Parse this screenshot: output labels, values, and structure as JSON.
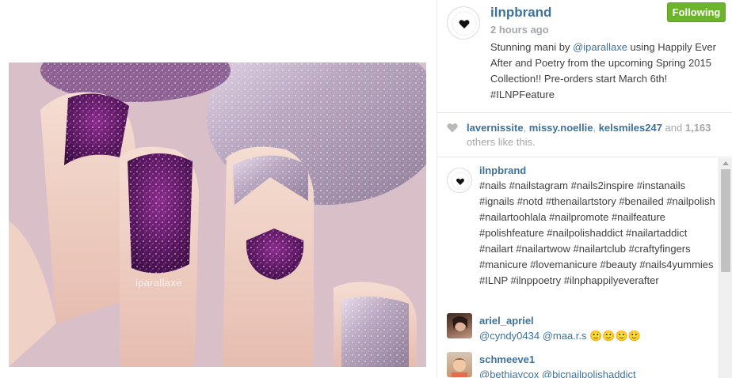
{
  "photo": {
    "watermark": "iparallaxe"
  },
  "post": {
    "owner": "ilnpbrand",
    "time": "2 hours ago",
    "follow_label": "Following",
    "caption_before": "Stunning mani by ",
    "caption_mention": "@iparallaxe",
    "caption_after": " using Happily Ever After and Poetry from the upcoming Spring 2015 Collection!! Pre-orders start March 6th! #ILNPFeature"
  },
  "likes": {
    "user1": "lavernissite",
    "sep1": ", ",
    "user2": "missy.noellie",
    "sep2": ", ",
    "user3": "kelsmiles247",
    "and": " and ",
    "count": "1,163",
    "suffix": " others like this."
  },
  "comments": [
    {
      "user": "ilnpbrand",
      "text": "#nails #nailstagram #nails2inspire #instanails #ignails #notd #thenailartstory #benailed #nailpolish #nailartoohlala #nailpromote #nailfeature #polishfeature #nailpolishaddict #nailartaddict #nailart #nailartwow #nailartclub #craftyfingers #manicure #lovemanicure #beauty #nails4yummies #ILNP #ilnppoetry #ilnphappilyeverafter"
    },
    {
      "user": "ariel_apriel",
      "text": "@cyndy0434 @maa.r.s 🙂🙂🙂🙂"
    },
    {
      "user": "schmeeve1",
      "text": "@bethjaycox @bjcnailpolishaddict"
    }
  ],
  "colors": {
    "link": "#3f729b",
    "follow_green": "#6bb42b",
    "muted": "#a5a7aa"
  }
}
